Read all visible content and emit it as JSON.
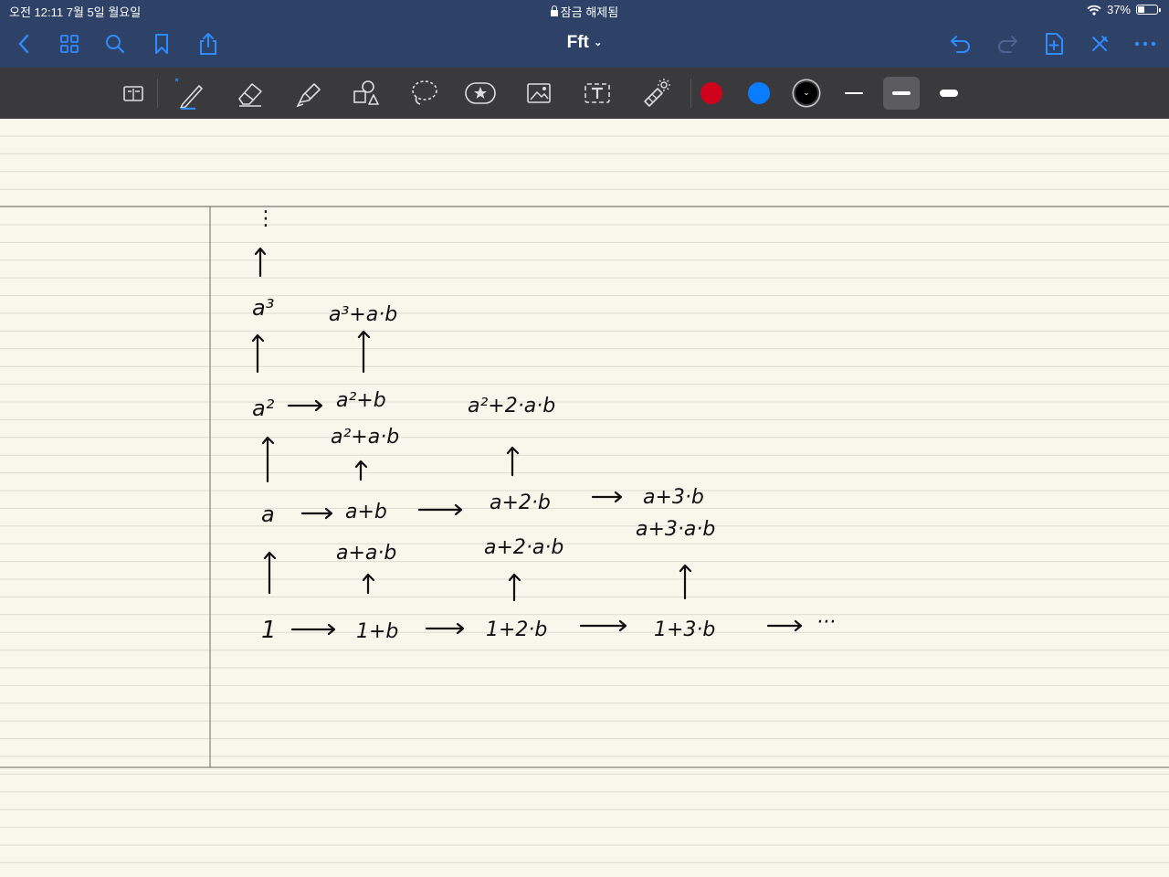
{
  "status_bar": {
    "time_date": "오전 12:11   7월 5일 월요일",
    "lock_label": "잠금 해제됨",
    "battery": "37%",
    "battery_level": 0.37
  },
  "nav": {
    "title": "Fft",
    "title_chevron": "chevron-down-icon"
  },
  "toolbar": {
    "colors": [
      "#d0021b",
      "#0a7cff",
      "#000000"
    ]
  },
  "note": {
    "line1": "⋮",
    "a_cubed": "a³",
    "a_cubed_plus_ab": "a³+a·b",
    "a_sq": "a²",
    "a_sq_plus_b": "a²+b",
    "a_sq_plus_2ab": "a²+2·a·b",
    "a_sq_plus_ab": "a²+a·b",
    "a": "a",
    "a_plus_b": "a+b",
    "a_plus_2b": "a+2·b",
    "a_plus_3b": "a+3·b",
    "a_plus_3ab": "a+3·a·b",
    "a_plus_ab": "a+a·b",
    "a_plus_2ab": "a+2·a·b",
    "one": "1",
    "one_plus_b": "1+b",
    "one_plus_2b": "1+2·b",
    "one_plus_3b": "1+3·b",
    "dots": "···"
  }
}
